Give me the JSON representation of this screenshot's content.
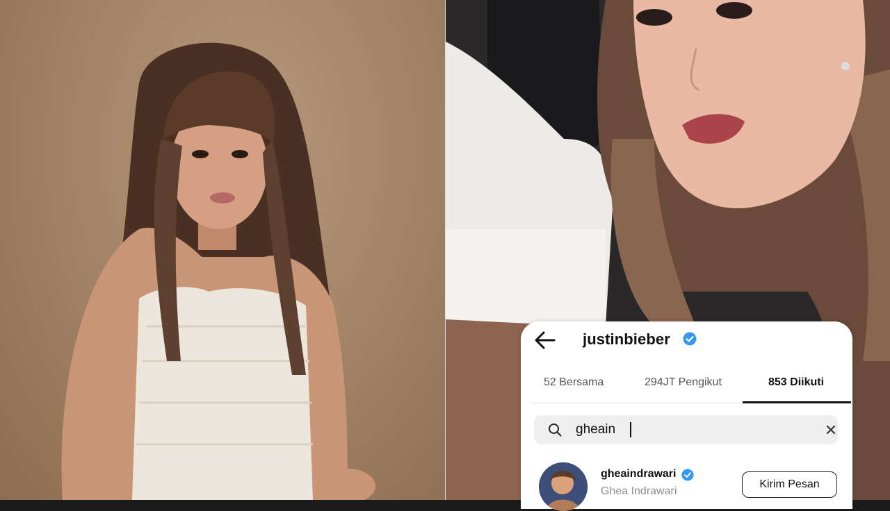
{
  "profile": {
    "username": "justinbieber"
  },
  "tabs": [
    {
      "label": "52 Bersama"
    },
    {
      "label": "294JT Pengikut"
    },
    {
      "label": "853 Diikuti"
    }
  ],
  "active_tab": 2,
  "search": {
    "value": "gheain"
  },
  "result": {
    "username": "gheaindrawari",
    "full_name": "Ghea Indrawari",
    "button_label": "Kirim Pesan"
  },
  "colors": {
    "verified": "#3897f0",
    "card_bg": "#ffffff",
    "search_bg": "#efefef"
  }
}
